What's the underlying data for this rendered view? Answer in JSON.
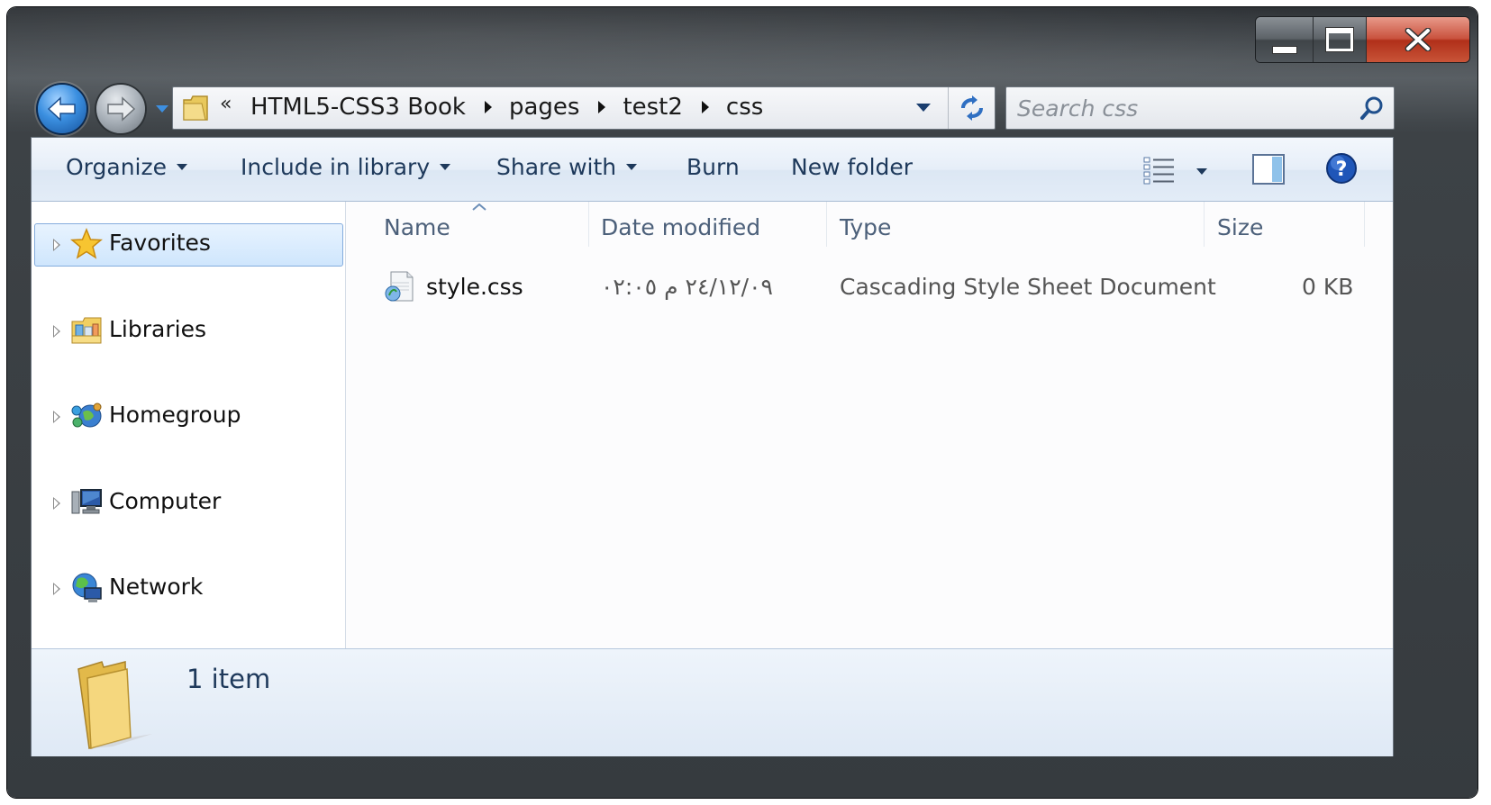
{
  "window": {
    "caption_buttons": [
      {
        "name": "minimize-button",
        "icon": "minimize-icon"
      },
      {
        "name": "maximize-button",
        "icon": "maximize-icon"
      },
      {
        "name": "close-button",
        "icon": "close-icon"
      }
    ],
    "colors": {
      "close_red": "#c9513d",
      "toolbar_text": "#1e395b",
      "header_text": "#4c607a",
      "selection_border": "#84acdd"
    }
  },
  "nav": {
    "back_icon": "back-arrow-icon",
    "forward_icon": "forward-arrow-icon",
    "recent_icon": "chevron-down-icon"
  },
  "address": {
    "overflow": "«",
    "crumbs": [
      "HTML5-CSS3 Book",
      "pages",
      "test2",
      "css"
    ],
    "icon": "folder-icon",
    "refresh_icon": "refresh-icon"
  },
  "search": {
    "placeholder": "Search css",
    "icon": "search-icon"
  },
  "toolbar": {
    "organize": "Organize",
    "include_in_library": "Include in library",
    "share_with": "Share with",
    "burn": "Burn",
    "new_folder": "New folder",
    "view_icon": "details-view-icon",
    "preview_icon": "preview-pane-icon",
    "help_icon": "help-icon"
  },
  "sidebar": {
    "items": [
      {
        "label": "Favorites",
        "icon": "star-icon",
        "selected": true
      },
      {
        "label": "Libraries",
        "icon": "libraries-icon",
        "selected": false
      },
      {
        "label": "Homegroup",
        "icon": "homegroup-icon",
        "selected": false
      },
      {
        "label": "Computer",
        "icon": "computer-icon",
        "selected": false
      },
      {
        "label": "Network",
        "icon": "network-icon",
        "selected": false
      }
    ]
  },
  "files": {
    "columns": [
      "Name",
      "Date modified",
      "Type",
      "Size"
    ],
    "sort_column": "Name",
    "rows": [
      {
        "name": "style.css",
        "date_modified": "٢٤/١٢/٠٩ م ٠٢:٠٥",
        "type": "Cascading Style Sheet Document",
        "size": "0 KB",
        "icon": "css-file-icon"
      }
    ]
  },
  "status": {
    "text": "1 item",
    "icon": "folder-large-icon"
  }
}
